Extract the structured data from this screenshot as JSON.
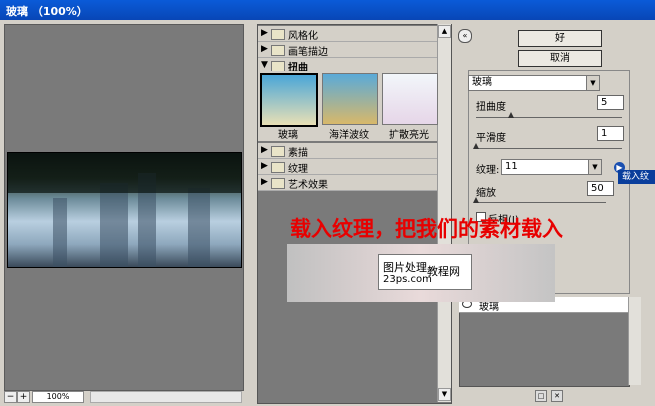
{
  "title": "玻璃 （100%）",
  "zoom": "100%",
  "categories": [
    {
      "label": "风格化",
      "expanded": false
    },
    {
      "label": "画笔描边",
      "expanded": false
    },
    {
      "label": "扭曲",
      "expanded": true
    },
    {
      "label": "素描",
      "expanded": false
    },
    {
      "label": "纹理",
      "expanded": false
    },
    {
      "label": "艺术效果",
      "expanded": false
    }
  ],
  "thumbs": [
    {
      "label": "玻璃",
      "selected": true
    },
    {
      "label": "海洋波纹",
      "selected": false
    },
    {
      "label": "扩散亮光",
      "selected": false
    }
  ],
  "buttons": {
    "ok": "好",
    "cancel": "取消"
  },
  "filter_select": "玻璃",
  "params": {
    "distortion_label": "扭曲度",
    "distortion_value": "5",
    "smoothness_label": "平滑度",
    "smoothness_value": "1",
    "texture_label": "纹理:",
    "texture_value": "11",
    "scale_label": "缩放",
    "scale_value": "50",
    "invert_label": "反相(I)"
  },
  "load_texture_menu": "载入纹",
  "layer_name": "玻璃",
  "overlay_text": "载入纹理，把我们的素材载入",
  "watermark": {
    "line1": "图片处理",
    "line2": "教程网",
    "line3": "23ps.com"
  },
  "colors": {
    "titlebar": "#0a5bd8",
    "overlay": "#e80000"
  }
}
